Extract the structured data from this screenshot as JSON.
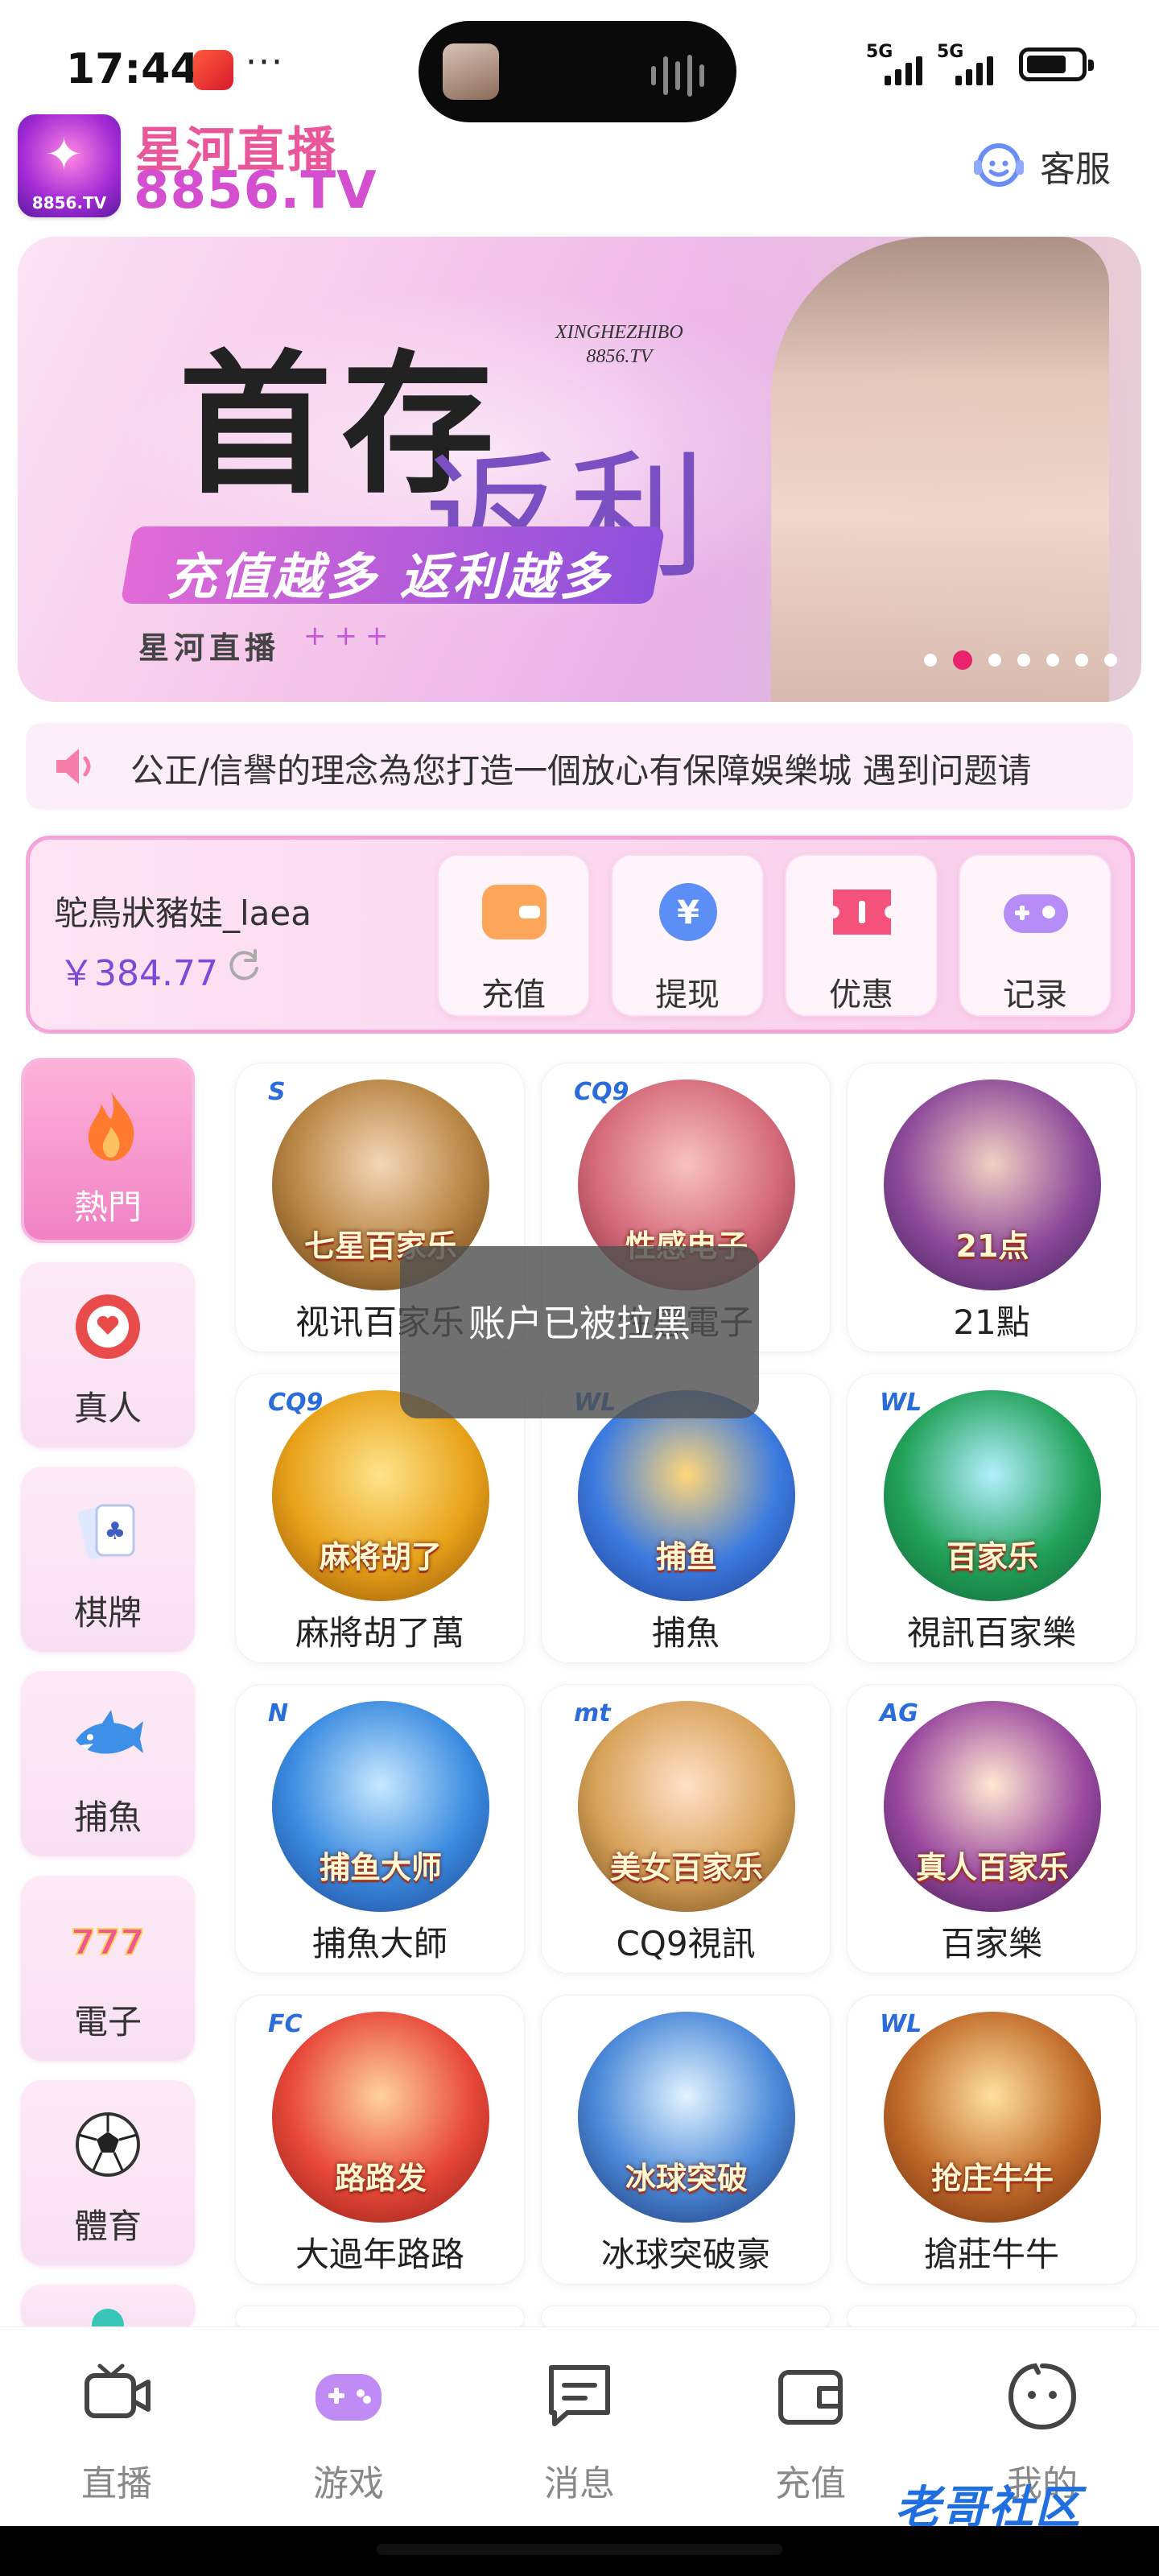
{
  "status_bar": {
    "time": "17:44",
    "more": "···",
    "signal1": "5G",
    "signal2": "5G"
  },
  "header": {
    "brand_name": "星河直播",
    "brand_domain": "8856.TV",
    "logo_caption": "8856.TV",
    "customer_service": "客服"
  },
  "banner": {
    "headline": "首存",
    "headline2": "返利",
    "site_line1": "XINGHEZHIBO",
    "site_line2": "8856.TV",
    "slogan": "充值越多  返利越多",
    "footer": "星河直播",
    "footer_stars": "+++",
    "slide_count": 7,
    "active_slide": 2
  },
  "marquee": {
    "text": "公正/信譽的理念為您打造一個放心有保障娛樂城  遇到问题请"
  },
  "account": {
    "username": "鸵鳥狀豬娃_laea",
    "balance": "￥384.77",
    "actions": [
      {
        "label": "充值",
        "icon": "wallet-icon"
      },
      {
        "label": "提现",
        "icon": "yuan-icon"
      },
      {
        "label": "优惠",
        "icon": "ticket-icon"
      },
      {
        "label": "记录",
        "icon": "gamepad-icon"
      }
    ]
  },
  "categories": [
    {
      "label": "熱門",
      "icon": "flame-icon"
    },
    {
      "label": "真人",
      "icon": "casino-chip-icon"
    },
    {
      "label": "棋牌",
      "icon": "cards-icon"
    },
    {
      "label": "捕魚",
      "icon": "shark-icon"
    },
    {
      "label": "電子",
      "icon": "slot-777-icon"
    },
    {
      "label": "體育",
      "icon": "soccer-ball-icon"
    }
  ],
  "games": [
    {
      "label": "视讯百家乐",
      "art_text": "七星百家乐",
      "logo": "S"
    },
    {
      "label": "性感電子",
      "art_text": "性感电子",
      "logo": "CQ9"
    },
    {
      "label": "21點",
      "art_text": "21点",
      "logo": ""
    },
    {
      "label": "麻將胡了萬",
      "art_text": "麻将胡了",
      "logo": "CQ9"
    },
    {
      "label": "捕魚",
      "art_text": "捕鱼",
      "logo": "WL"
    },
    {
      "label": "視訊百家樂",
      "art_text": "百家乐",
      "logo": "WL"
    },
    {
      "label": "捕魚大師",
      "art_text": "捕鱼大师",
      "logo": "N"
    },
    {
      "label": "CQ9視訊",
      "art_text": "美女百家乐",
      "logo": "mt"
    },
    {
      "label": "百家樂",
      "art_text": "真人百家乐",
      "logo": "AG"
    },
    {
      "label": "大過年路路",
      "art_text": "路路发",
      "logo": "FC"
    },
    {
      "label": "冰球突破豪",
      "art_text": "冰球突破",
      "logo": ""
    },
    {
      "label": "搶莊牛牛",
      "art_text": "抢庄牛牛",
      "logo": "WL"
    }
  ],
  "toast": {
    "text": "账户已被拉黑"
  },
  "bottom_nav": [
    {
      "label": "直播",
      "icon": "video-camera-icon"
    },
    {
      "label": "游戏",
      "icon": "gamepad-icon"
    },
    {
      "label": "消息",
      "icon": "message-icon"
    },
    {
      "label": "充值",
      "icon": "wallet-icon"
    },
    {
      "label": "我的",
      "icon": "face-icon"
    }
  ],
  "watermark": "老哥社区",
  "colors": {
    "brand_pink": "#e9579a",
    "brand_purple": "#7e48d8",
    "active_dot": "#e8226c"
  }
}
